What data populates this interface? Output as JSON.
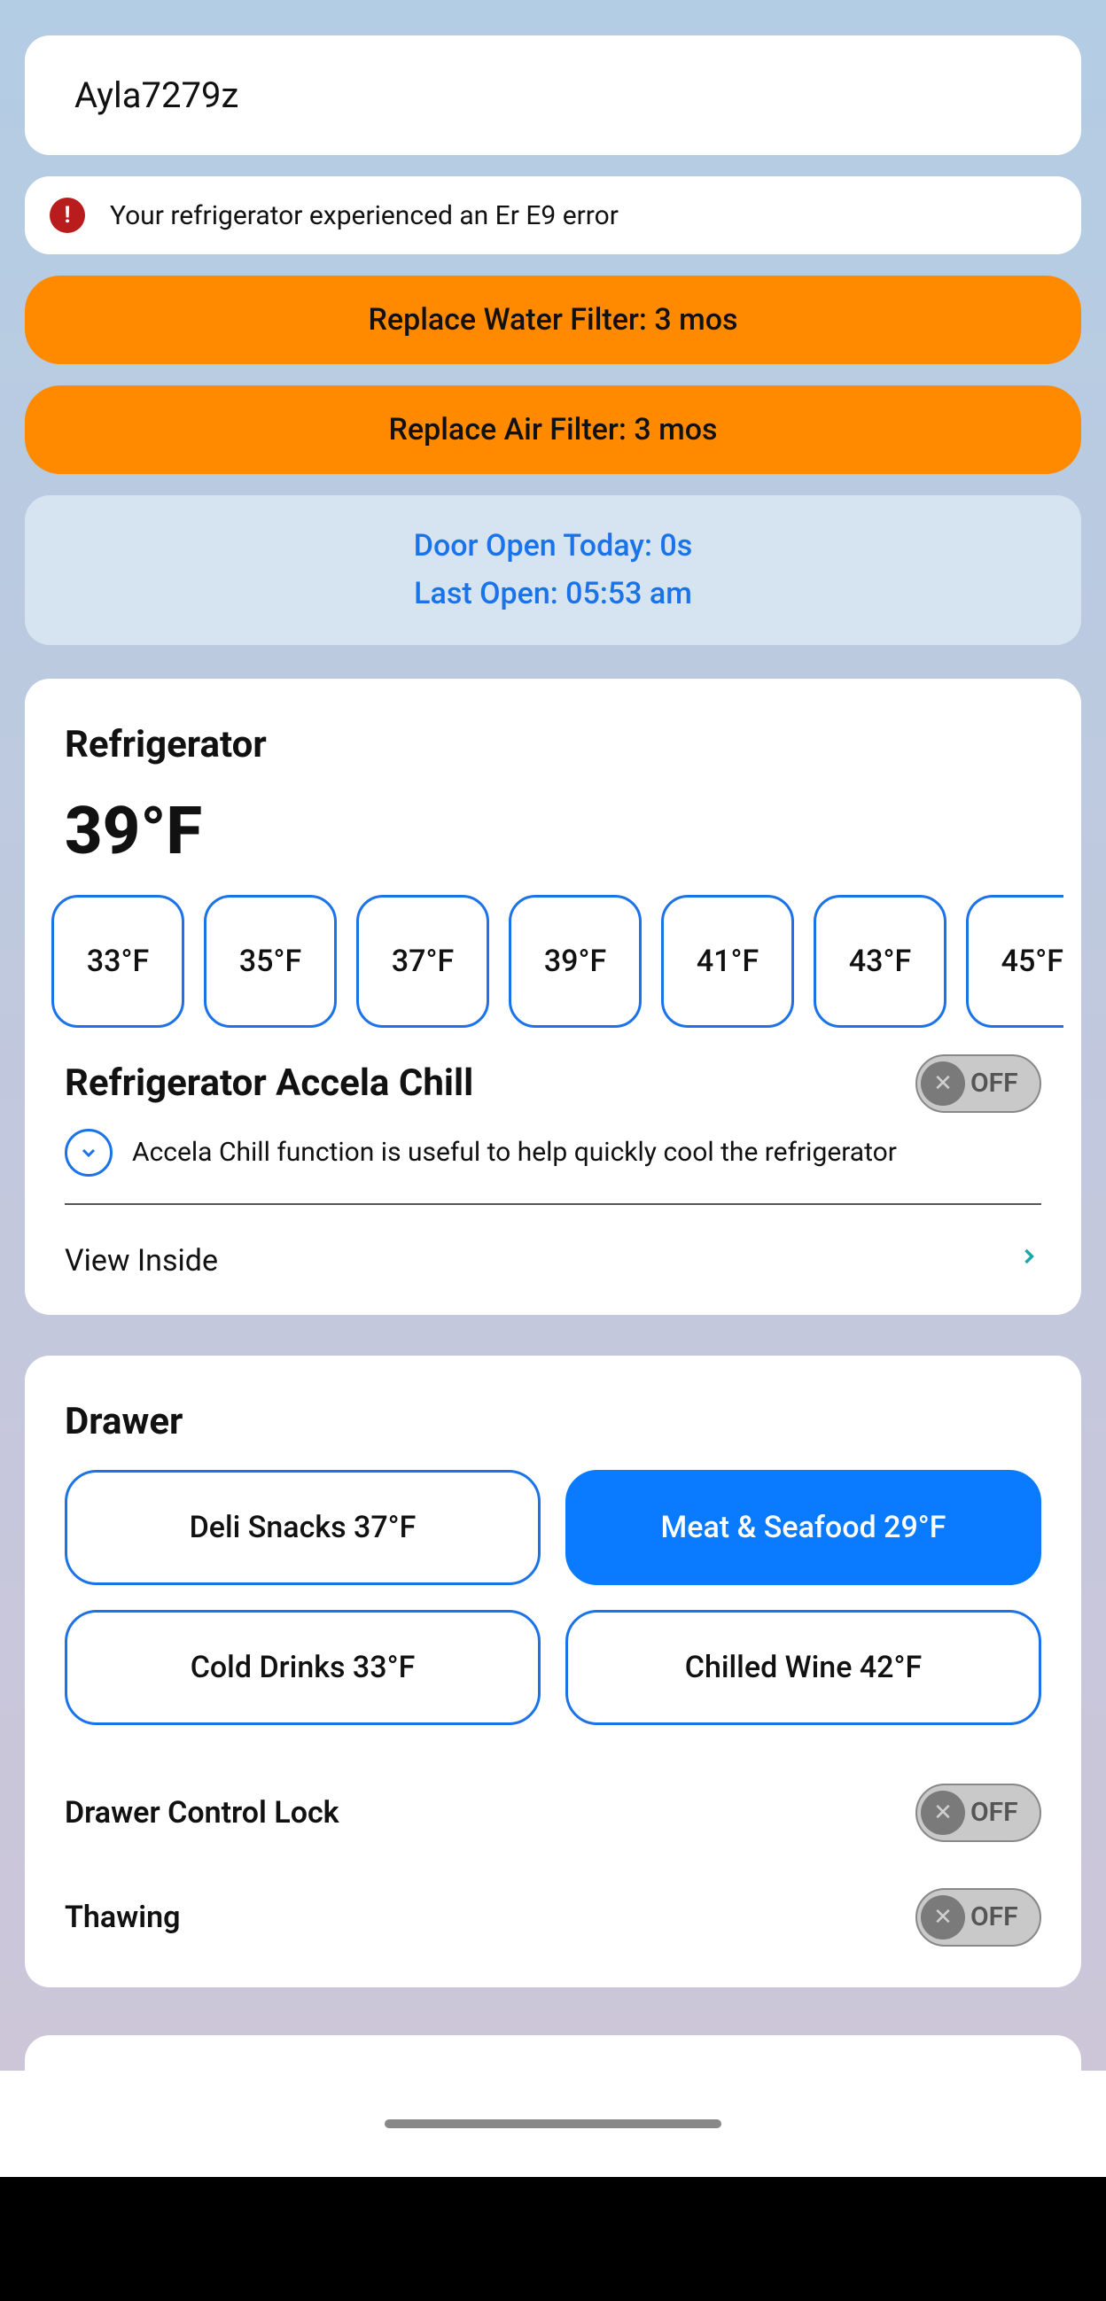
{
  "device_name": "Ayla7279z",
  "error": {
    "icon_glyph": "!",
    "message": "Your refrigerator experienced an Er E9 error"
  },
  "alerts": [
    "Replace Water Filter: 3 mos",
    "Replace Air Filter: 3 mos"
  ],
  "door_info": {
    "open_today": "Door Open Today: 0s",
    "last_open": "Last Open: 05:53 am"
  },
  "fridge": {
    "title": "Refrigerator",
    "current_temp": "39°F",
    "temps": [
      "33°F",
      "35°F",
      "37°F",
      "39°F",
      "41°F",
      "43°F",
      "45°F"
    ],
    "accela_title": "Refrigerator Accela Chill",
    "accela_state": "OFF",
    "accela_desc": "Accela Chill function is useful to help quickly cool the refrigerator",
    "view_inside": "View Inside"
  },
  "drawer": {
    "title": "Drawer",
    "options": [
      {
        "label": "Deli Snacks 37°F",
        "active": false
      },
      {
        "label": "Meat & Seafood 29°F",
        "active": true
      },
      {
        "label": "Cold Drinks 33°F",
        "active": false
      },
      {
        "label": "Chilled Wine 42°F",
        "active": false
      }
    ],
    "control_lock_label": "Drawer Control Lock",
    "control_lock_state": "OFF",
    "thawing_label": "Thawing",
    "thawing_state": "OFF"
  }
}
